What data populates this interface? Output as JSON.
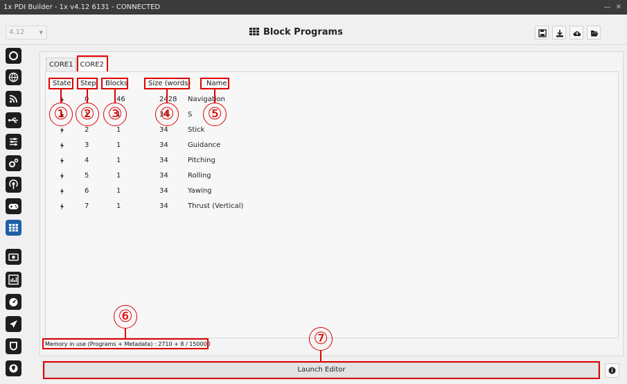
{
  "window": {
    "title": "1x PDI Builder - 1x v4.12 6131 - CONNECTED",
    "controls": "— ✕"
  },
  "toolbar": {
    "version": "4.12",
    "title": "Block Programs"
  },
  "tabs": [
    {
      "label": "CORE1"
    },
    {
      "label": "CORE2"
    }
  ],
  "table": {
    "headers": {
      "state": "State",
      "step": "Step",
      "blocks": "Blocks",
      "size": "Size (words)",
      "name": "Name"
    },
    "rows": [
      {
        "step": "0",
        "blocks": "46",
        "size": "2428",
        "name": "Navigation"
      },
      {
        "step": "1",
        "blocks": "1",
        "size": "34",
        "name": "S"
      },
      {
        "step": "2",
        "blocks": "1",
        "size": "34",
        "name": "Stick"
      },
      {
        "step": "3",
        "blocks": "1",
        "size": "34",
        "name": "Guidance"
      },
      {
        "step": "4",
        "blocks": "1",
        "size": "34",
        "name": "Pitching"
      },
      {
        "step": "5",
        "blocks": "1",
        "size": "34",
        "name": "Rolling"
      },
      {
        "step": "6",
        "blocks": "1",
        "size": "34",
        "name": "Yawing"
      },
      {
        "step": "7",
        "blocks": "1",
        "size": "34",
        "name": "Thrust (Vertical)"
      }
    ]
  },
  "markers": [
    "①",
    "②",
    "③",
    "④",
    "⑤",
    "⑥",
    "⑦"
  ],
  "footer": {
    "memory": "Memory in use (Programs + Metadata) : 2710 + 8 / 150000",
    "launch_label": "Launch Editor"
  },
  "colors": {
    "annotation_red": "#e00000",
    "sidebar_icon": "#1e1e1e",
    "sidebar_active": "#1f5fa8"
  },
  "sidebar": {
    "items": [
      {
        "icon": "power-icon"
      },
      {
        "icon": "globe-icon"
      },
      {
        "icon": "rss-icon"
      },
      {
        "icon": "usb-icon"
      },
      {
        "icon": "sliders-icon"
      },
      {
        "icon": "gears-icon"
      },
      {
        "icon": "signal-icon"
      },
      {
        "icon": "gamepad-icon"
      },
      {
        "icon": "block-programs-icon",
        "active": true
      },
      {
        "icon": "camera-icon"
      },
      {
        "icon": "chart-icon"
      },
      {
        "icon": "dashboard-icon"
      },
      {
        "icon": "plane-icon"
      },
      {
        "icon": "shield-icon"
      },
      {
        "icon": "location-icon"
      }
    ]
  }
}
